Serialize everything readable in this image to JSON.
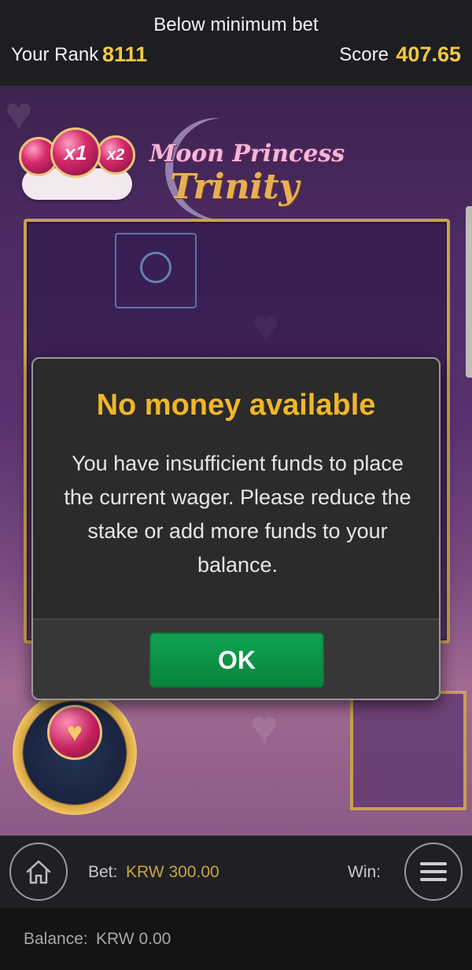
{
  "topbar": {
    "notice": "Below minimum bet",
    "rank_label": "Your Rank",
    "rank_value": "8111",
    "score_label": "Score",
    "score_value": "407.65"
  },
  "game": {
    "logo_line1": "Moon Princess",
    "logo_line2": "Trinity",
    "multipliers": [
      "x1",
      "x2"
    ]
  },
  "dialog": {
    "title": "No money available",
    "message": "You have insufficient funds to place the current wager. Please reduce the stake or add more funds to your balance.",
    "ok_label": "OK"
  },
  "controls": {
    "bet_label": "Bet:",
    "bet_value": "KRW 300.00",
    "win_label": "Win:",
    "balance_label": "Balance:",
    "balance_value": "KRW 0.00"
  },
  "colors": {
    "accent_gold": "#f2b627",
    "ok_green": "#10a352",
    "dialog_bg": "#2a2b2a"
  },
  "icons": [
    "home-icon",
    "menu-icon",
    "heart-icon"
  ]
}
